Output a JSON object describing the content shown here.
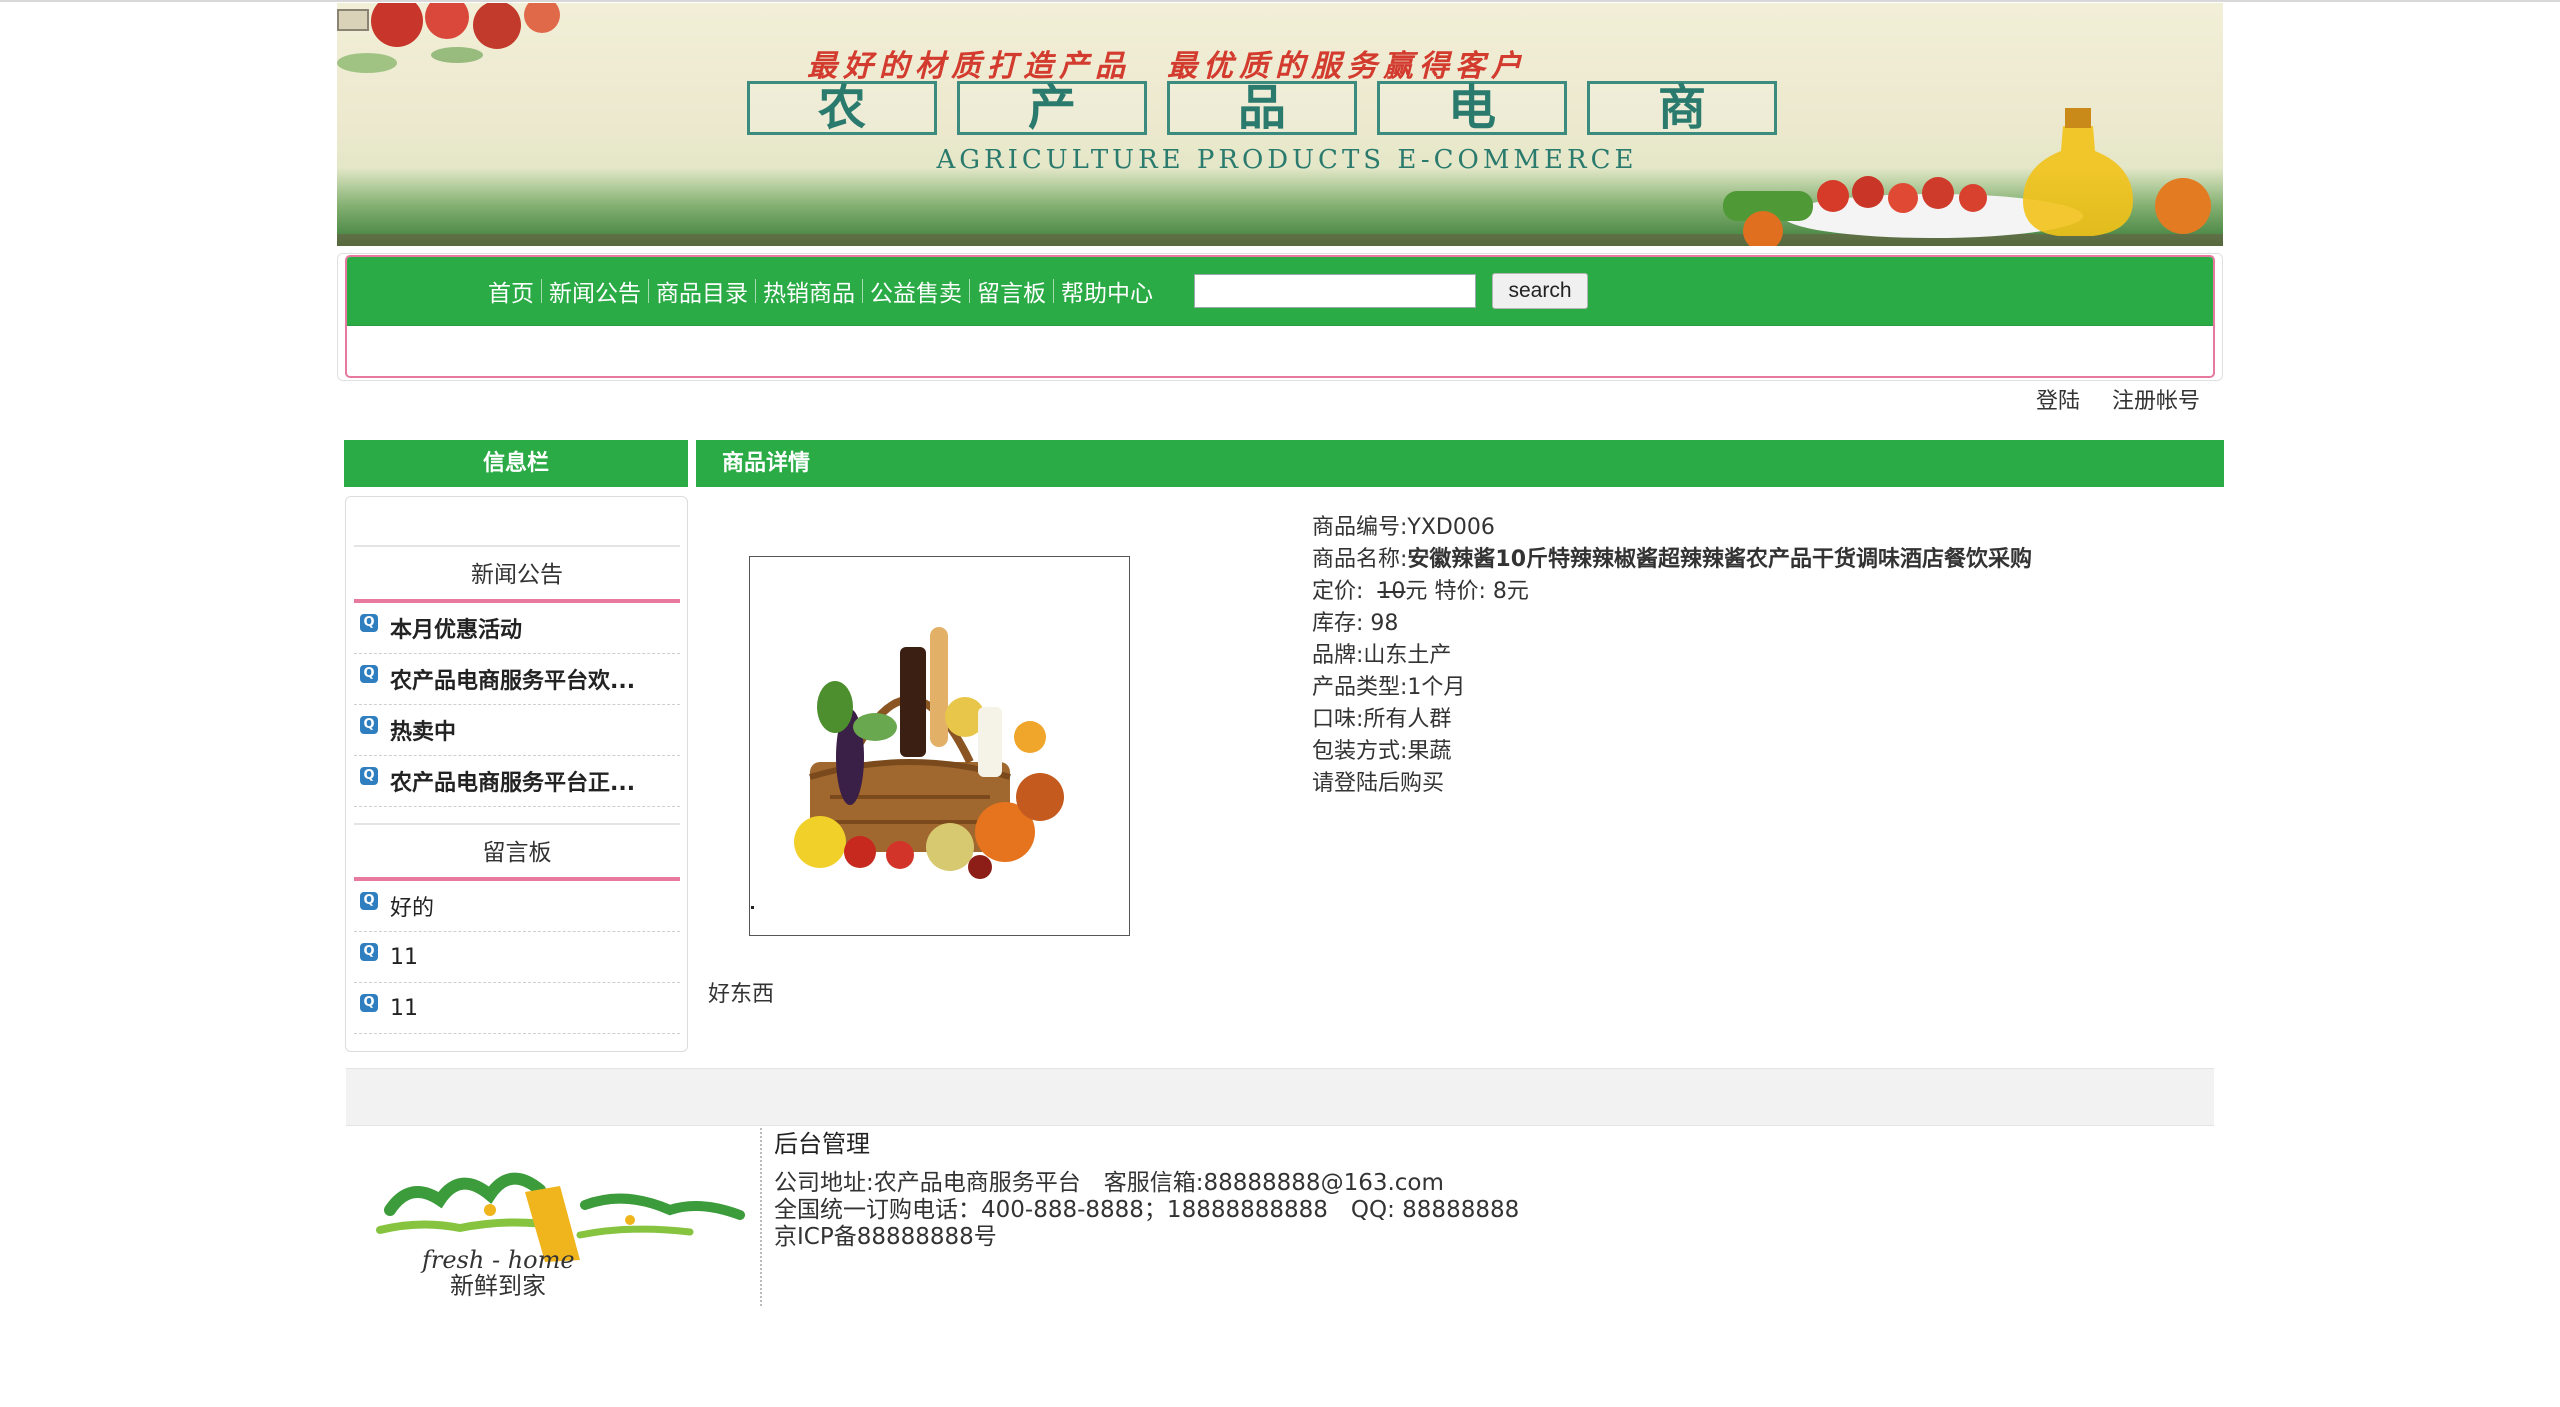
{
  "banner": {
    "slogan": "最好的材质打造产品　最优质的服务赢得客户",
    "title_chars": [
      "农",
      "产",
      "品",
      "电",
      "商"
    ],
    "subtitle": "AGRICULTURE PRODUCTS E-COMMERCE",
    "icon": "broken-image-icon"
  },
  "nav": {
    "links": [
      "首页",
      "新闻公告",
      "商品目录",
      "热销商品",
      "公益售卖",
      "留言板",
      "帮助中心"
    ],
    "search_value": "",
    "search_button": "search"
  },
  "auth": {
    "login": "登陆",
    "register": "注册帐号"
  },
  "sidebar": {
    "header": "信息栏",
    "news_title": "新闻公告",
    "news": [
      "本月优惠活动",
      "农产品电商服务平台欢...",
      "热卖中",
      "农产品电商服务平台正..."
    ],
    "board_title": "留言板",
    "messages": [
      "好的",
      "11",
      "11"
    ],
    "item_icon": "q-bullet-icon"
  },
  "product": {
    "header": "商品详情",
    "code_label": "商品编号:",
    "code": "YXD006",
    "name_label": "商品名称:",
    "name": "安徽辣酱10斤特辣辣椒酱超辣辣酱农产品干货调味酒店餐饮采购",
    "price_label": "定价:",
    "price": "10",
    "price_unit": "元",
    "special_label": "特价:",
    "special": "8元",
    "stock_label": "库存:",
    "stock": "98",
    "brand_label": "品牌:",
    "brand": "山东土产",
    "type_label": "产品类型:",
    "type": "1个月",
    "taste_label": "口味:",
    "taste": "所有人群",
    "package_label": "包装方式:",
    "package": "果蔬",
    "notice": "请登陆后购买",
    "description": "好东西",
    "image_icon": "vegetable-basket-image"
  },
  "footer": {
    "admin": "后台管理",
    "address": "公司地址:农产品电商服务平台　客服信箱:88888888@163.com",
    "phone": "全国统一订购电话：400-888-8888；18888888888　QQ: 88888888",
    "icp": "京ICP备88888888号",
    "logo_script": "fresh - home",
    "logo_cn": "新鲜到家"
  },
  "colors": {
    "nav_green": "#2bab46",
    "accent_pink": "#e8799e",
    "q_icon_blue": "#2f7fc0"
  }
}
